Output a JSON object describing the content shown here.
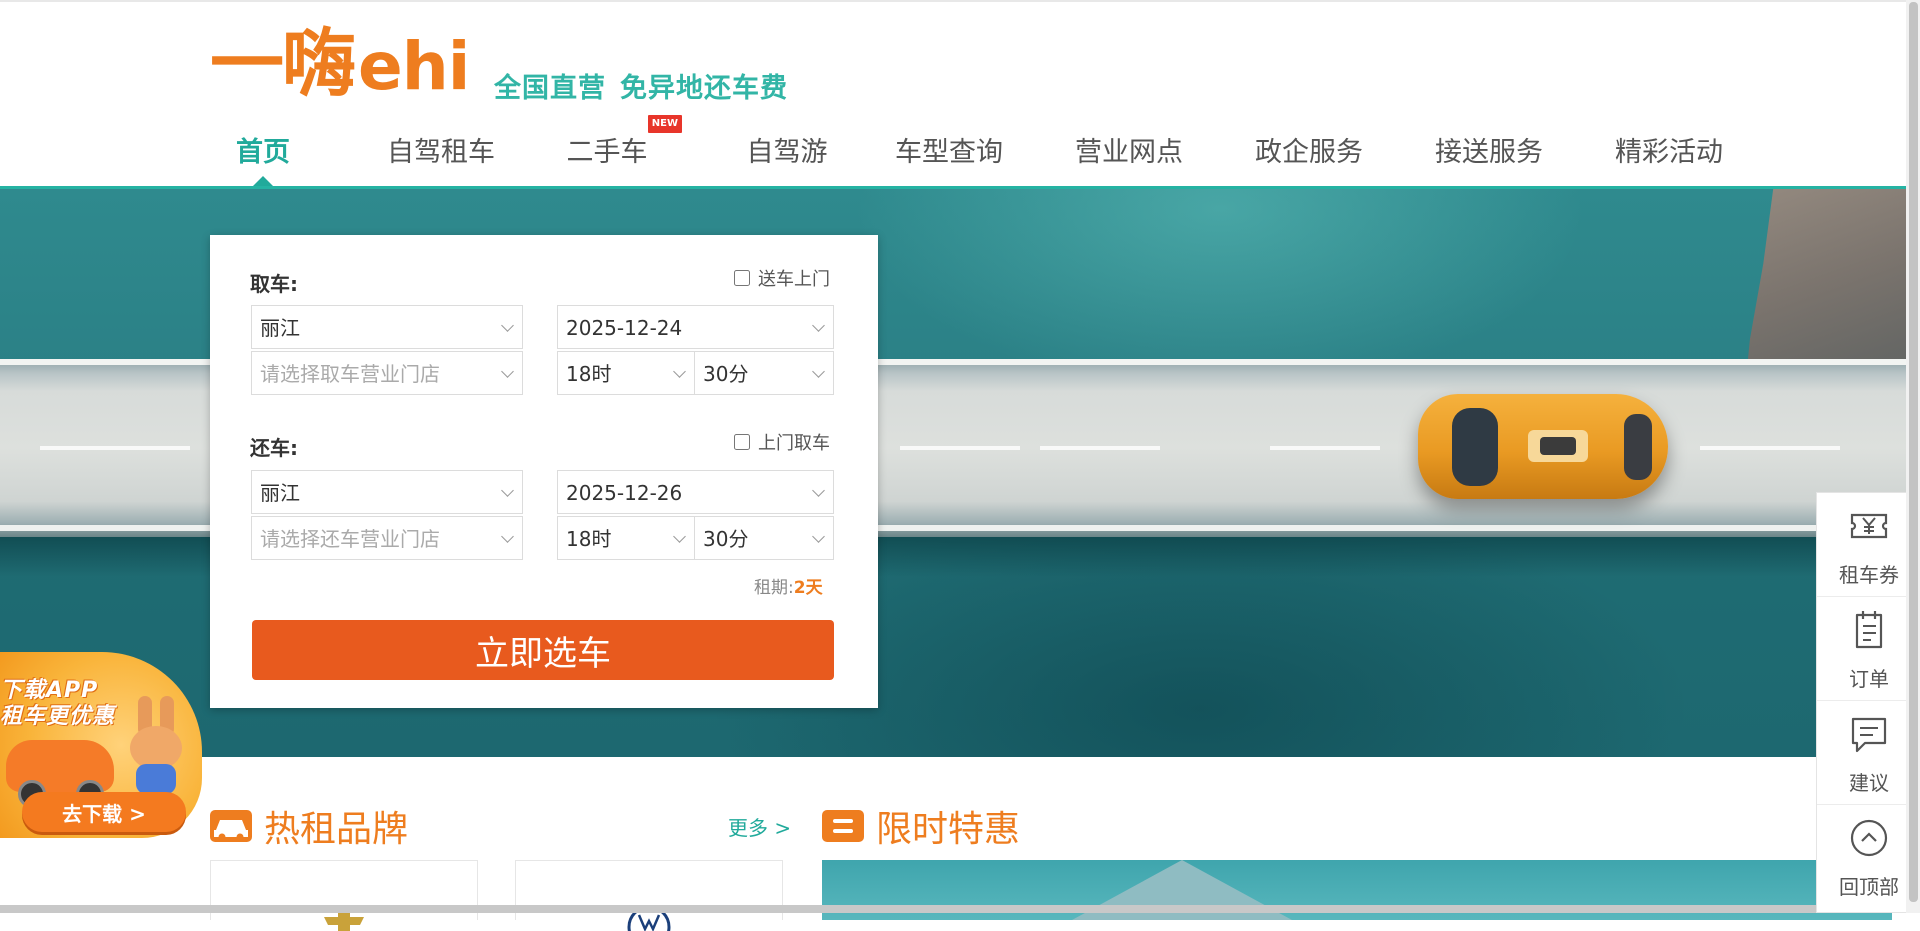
{
  "header": {
    "logo_mark": "一嗨",
    "logo_ehi": "ehi",
    "slogan_1": "全国直营",
    "slogan_2": "免异地还车费"
  },
  "nav": {
    "items": [
      {
        "label": "首页",
        "active": true
      },
      {
        "label": "自驾租车"
      },
      {
        "label": "二手车",
        "badge": "NEW"
      },
      {
        "label": "自驾游"
      },
      {
        "label": "车型查询"
      },
      {
        "label": "营业网点"
      },
      {
        "label": "政企服务"
      },
      {
        "label": "接送服务"
      },
      {
        "label": "精彩活动"
      }
    ]
  },
  "booking": {
    "pickup": {
      "label": "取车:",
      "delivery_option": "送车上门",
      "delivery_checked": false,
      "city": "丽江",
      "date": "2025-12-24",
      "store_placeholder": "请选择取车营业门店",
      "hour": "18时",
      "minute": "30分"
    },
    "return": {
      "label": "还车:",
      "delivery_option": "上门取车",
      "delivery_checked": false,
      "city": "丽江",
      "date": "2025-12-26",
      "store_placeholder": "请选择还车营业门店",
      "hour": "18时",
      "minute": "30分"
    },
    "duration_label": "租期:",
    "duration_value": "2天",
    "submit_label": "立即选车"
  },
  "promo": {
    "line_1": "下载APP",
    "line_2": "租车更优惠",
    "button_label": "去下载 >"
  },
  "sections": {
    "hot_brands": {
      "title": "热租品牌",
      "more_label": "更多 >"
    },
    "limited_offer": {
      "title": "限时特惠"
    }
  },
  "float_bar": {
    "items": [
      {
        "label": "租车券",
        "icon": "coupon-yen-icon"
      },
      {
        "label": "订单",
        "icon": "order-list-icon"
      },
      {
        "label": "建议",
        "icon": "message-icon"
      },
      {
        "label": "回顶部",
        "icon": "back-to-top-icon"
      }
    ]
  },
  "colors": {
    "brand_orange": "#ee7d1f",
    "brand_teal": "#21aa9b",
    "button_orange": "#e85a1e"
  }
}
